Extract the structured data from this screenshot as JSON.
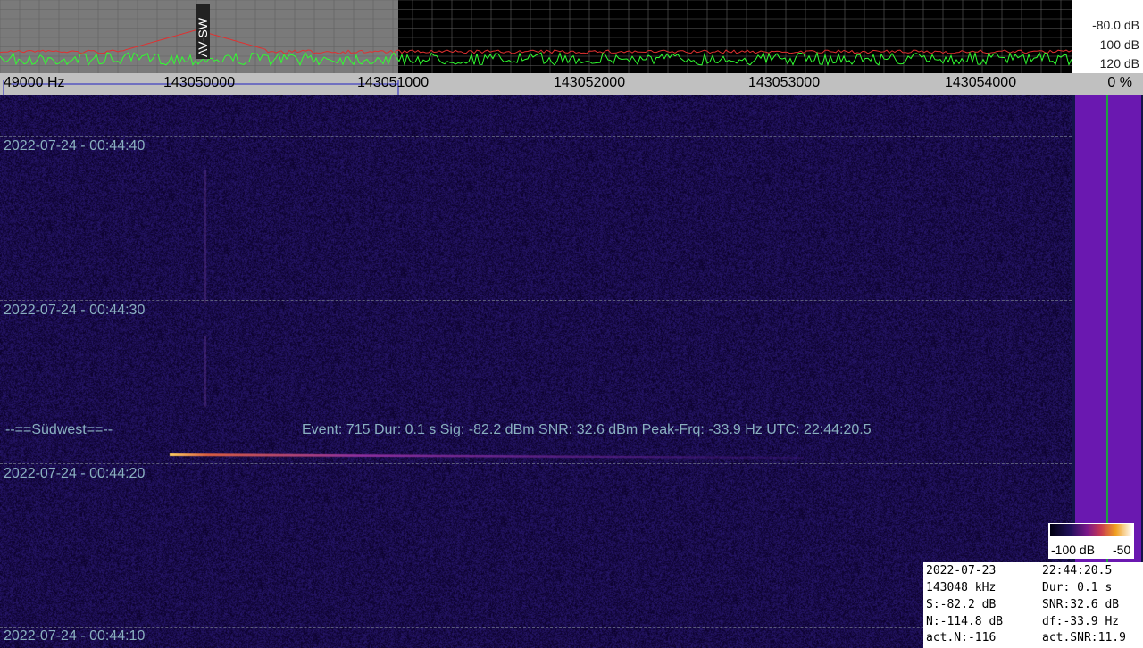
{
  "spectrum": {
    "db_labels": [
      "-80.0 dB",
      "100 dB",
      "120 dB"
    ],
    "marker_label": "AV-SW",
    "colors": {
      "peak": "#e03030",
      "current": "#30ff30",
      "grid": "#606060",
      "highlight": "#7a7a7a"
    }
  },
  "freq_ruler": {
    "labels": [
      "49000 Hz",
      "143050000",
      "143051000",
      "143052000",
      "143053000",
      "143054000"
    ]
  },
  "level_meter": {
    "percent": "0 %"
  },
  "waterfall": {
    "timestamps": [
      "2022-07-24 - 00:44:40",
      "2022-07-24 - 00:44:30",
      "2022-07-24 - 00:44:20",
      "2022-07-24 - 00:44:10"
    ],
    "direction": "--==Südwest==--",
    "event_details": "Event: 715   Dur: 0.1 s   Sig: -82.2 dBm   SNR: 32.6 dBm   Peak-Frq: -33.9 Hz   UTC: 22:44:20.5"
  },
  "colorbar": {
    "min_label": "-100 dB",
    "max_label": "-50"
  },
  "info": {
    "date": "2022-07-23",
    "time": "22:44:20.5",
    "freq": "143048 kHz",
    "dur": "Dur: 0.1 s",
    "signal": "S:-82.2 dB",
    "snr": "SNR:32.6 dB",
    "noise": "N:-114.8 dB",
    "df": "df:-33.9 Hz",
    "act_noise": "act.N:-116",
    "act_snr": "act.SNR:11.9"
  }
}
